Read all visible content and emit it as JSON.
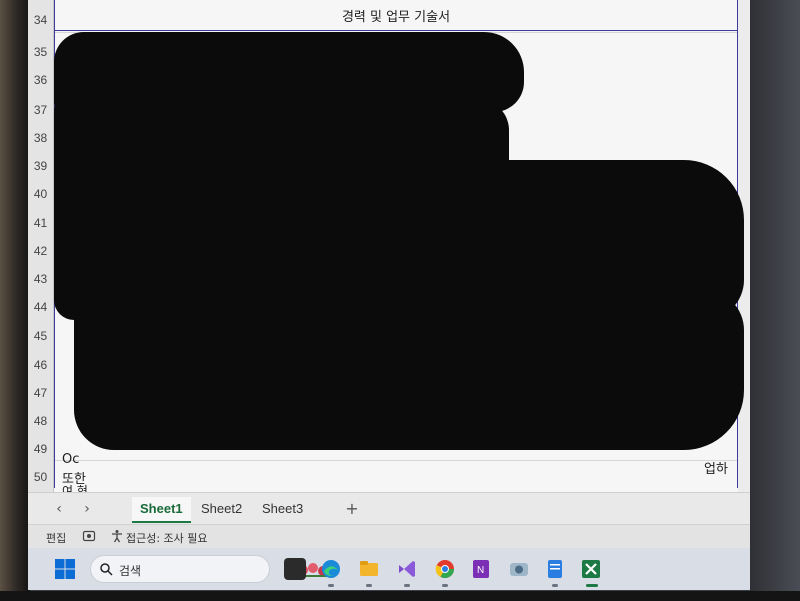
{
  "document": {
    "title": "경력 및 업무 기술서"
  },
  "rows": {
    "numbers": [
      "34",
      "35",
      "36",
      "37",
      "38",
      "39",
      "40",
      "41",
      "42",
      "43",
      "44",
      "45",
      "46",
      "47",
      "48",
      "49",
      "50"
    ]
  },
  "visible_fragments": {
    "row49": "Oc",
    "row50a": "또한",
    "row50b": "여 현",
    "row50c": "업하"
  },
  "sheets": {
    "tabs": [
      "Sheet1",
      "Sheet2",
      "Sheet3"
    ],
    "active": "Sheet1",
    "add_label": "+"
  },
  "status": {
    "mode": "편집",
    "accessibility": "접근성: 조사 필요"
  },
  "taskbar": {
    "search_placeholder": "검색",
    "apps": [
      "task-view-icon",
      "edge-icon",
      "file-explorer-icon",
      "visual-studio-icon",
      "chrome-icon",
      "onenote-icon",
      "camera-icon",
      "notepad-icon",
      "excel-icon"
    ]
  },
  "colors": {
    "excel_green": "#1e7a44",
    "border_blue": "#3b3b9a",
    "redaction": "#0b0b0b"
  }
}
